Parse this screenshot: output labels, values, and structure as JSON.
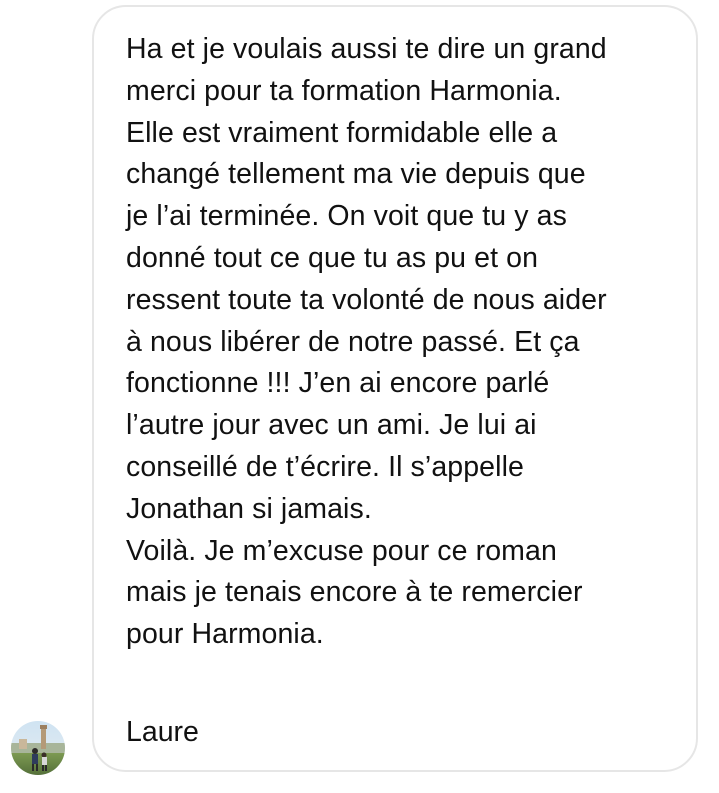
{
  "message": {
    "lines": [
      "Ha et je voulais aussi te dire un grand",
      "merci pour ta formation Harmonia.",
      "Elle est vraiment formidable elle a",
      "changé tellement ma vie depuis que",
      "je l’ai terminée. On voit que tu y as",
      "donné tout ce que tu as pu et on",
      "ressent toute ta volonté de nous aider",
      "à nous libérer de notre passé. Et ça",
      "fonctionne !!! J’en ai encore parlé",
      "l’autre jour avec un ami. Je lui ai",
      "conseillé de t’écrire. Il s’appelle",
      "Jonathan si jamais.",
      "Voilà. Je m’excuse pour ce roman",
      "mais je tenais encore à te remercier",
      "pour Harmonia."
    ],
    "signature": "Laure"
  },
  "sender": {
    "avatar_icon": "profile-photo-icon"
  },
  "colors": {
    "text": "#111111",
    "bubble_border": "#e6e6e6",
    "background": "#ffffff"
  }
}
